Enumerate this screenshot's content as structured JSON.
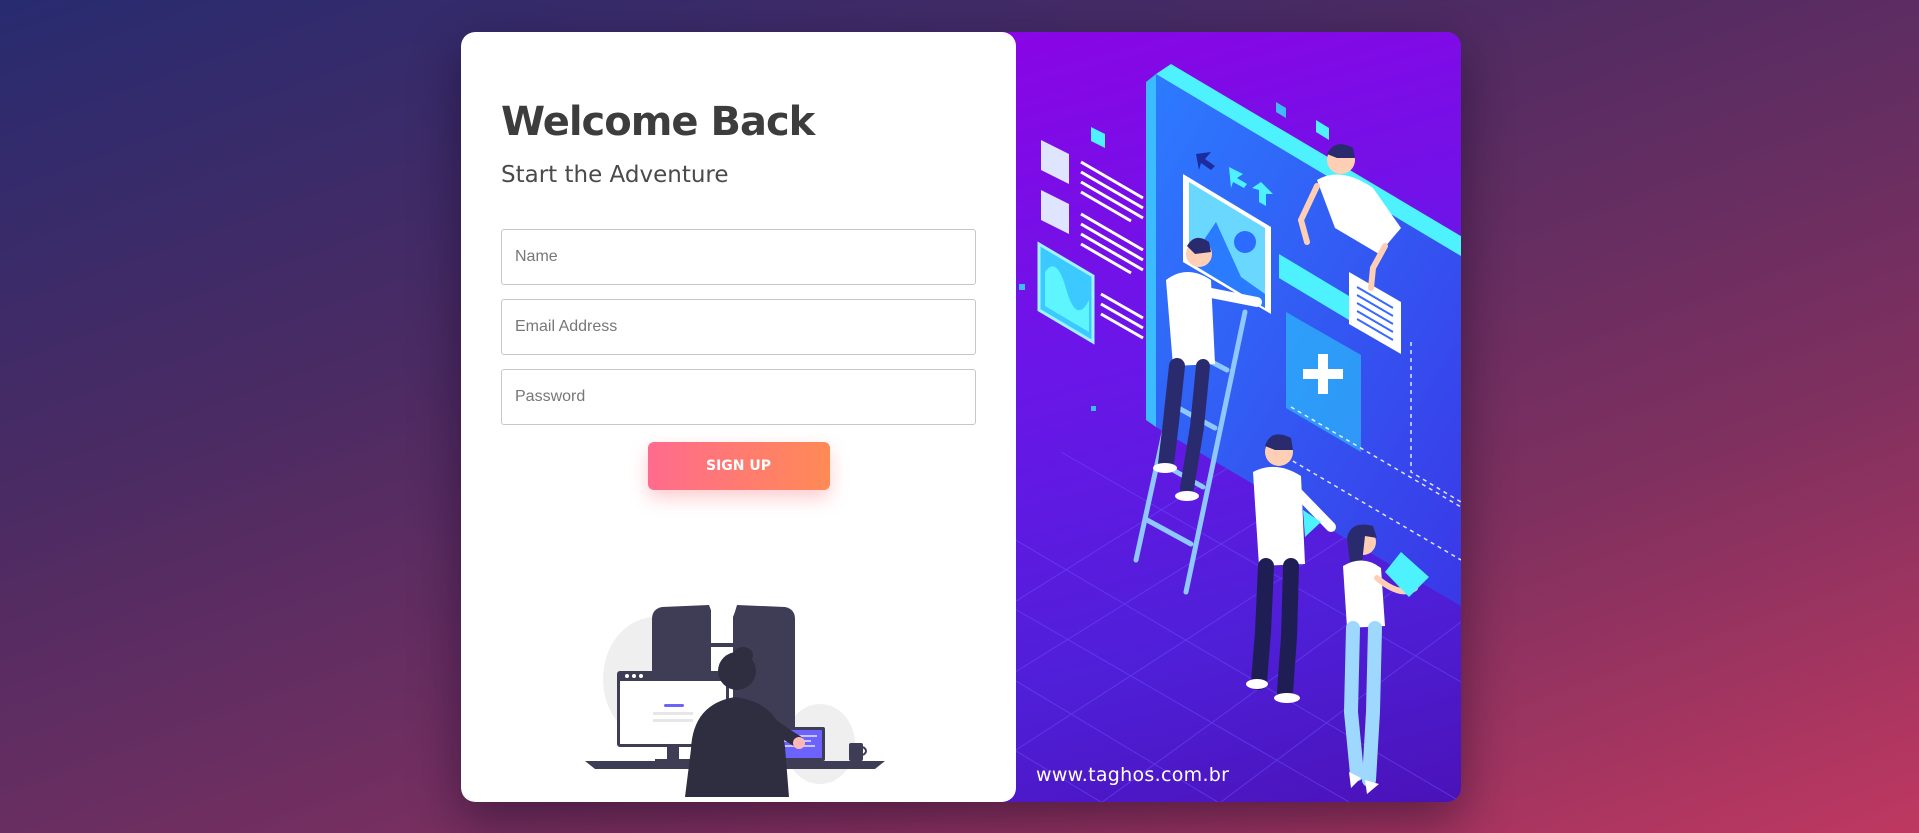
{
  "form": {
    "title": "Welcome Back",
    "subtitle": "Start the Adventure",
    "name_placeholder": "Name",
    "email_placeholder": "Email Address",
    "password_placeholder": "Password",
    "submit_label": "SIGN UP"
  },
  "promo": {
    "website": "www.taghos.com.br"
  },
  "colors": {
    "button_start": "#ff6b8d",
    "button_end": "#ff8a55",
    "panel_purple": "#8a05e6",
    "panel_blue": "#4f1fd8"
  }
}
